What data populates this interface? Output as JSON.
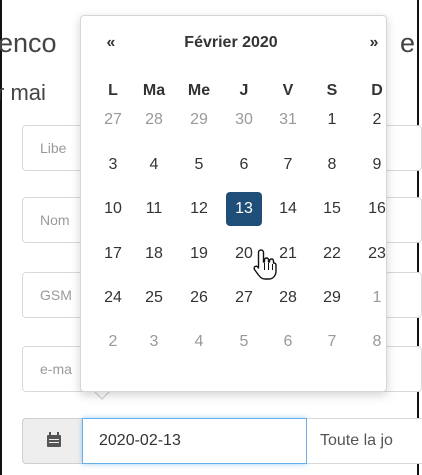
{
  "background": {
    "title_left": "enco",
    "title_right": "e",
    "subtitle": "r mai",
    "fields": [
      {
        "placeholder": "Libe"
      },
      {
        "placeholder": "Nom"
      },
      {
        "placeholder": "GSM"
      },
      {
        "placeholder": "e-ma"
      }
    ],
    "date_value": "2020-02-13",
    "allday_label": "Toute la jo"
  },
  "datepicker": {
    "prev_label": "«",
    "month_label": "Février 2020",
    "next_label": "»",
    "weekdays": [
      "L",
      "Ma",
      "Me",
      "J",
      "V",
      "S",
      "D"
    ],
    "weeks": [
      [
        {
          "d": "27",
          "m": true
        },
        {
          "d": "28",
          "m": true
        },
        {
          "d": "29",
          "m": true
        },
        {
          "d": "30",
          "m": true
        },
        {
          "d": "31",
          "m": true
        },
        {
          "d": "1"
        },
        {
          "d": "2"
        }
      ],
      [
        {
          "d": "3"
        },
        {
          "d": "4"
        },
        {
          "d": "5"
        },
        {
          "d": "6"
        },
        {
          "d": "7"
        },
        {
          "d": "8"
        },
        {
          "d": "9"
        }
      ],
      [
        {
          "d": "10"
        },
        {
          "d": "11"
        },
        {
          "d": "12"
        },
        {
          "d": "13",
          "sel": true
        },
        {
          "d": "14"
        },
        {
          "d": "15"
        },
        {
          "d": "16"
        }
      ],
      [
        {
          "d": "17"
        },
        {
          "d": "18"
        },
        {
          "d": "19"
        },
        {
          "d": "20"
        },
        {
          "d": "21"
        },
        {
          "d": "22"
        },
        {
          "d": "23"
        }
      ],
      [
        {
          "d": "24"
        },
        {
          "d": "25"
        },
        {
          "d": "26"
        },
        {
          "d": "27"
        },
        {
          "d": "28"
        },
        {
          "d": "29"
        },
        {
          "d": "1",
          "m": true
        }
      ],
      [
        {
          "d": "2",
          "m": true
        },
        {
          "d": "3",
          "m": true
        },
        {
          "d": "4",
          "m": true
        },
        {
          "d": "5",
          "m": true
        },
        {
          "d": "6",
          "m": true
        },
        {
          "d": "7",
          "m": true
        },
        {
          "d": "8",
          "m": true
        }
      ]
    ],
    "selected_color": "#1f4e79"
  },
  "icons": {
    "date_addon": "calendar-icon",
    "cursor": "hand-pointer-icon"
  }
}
